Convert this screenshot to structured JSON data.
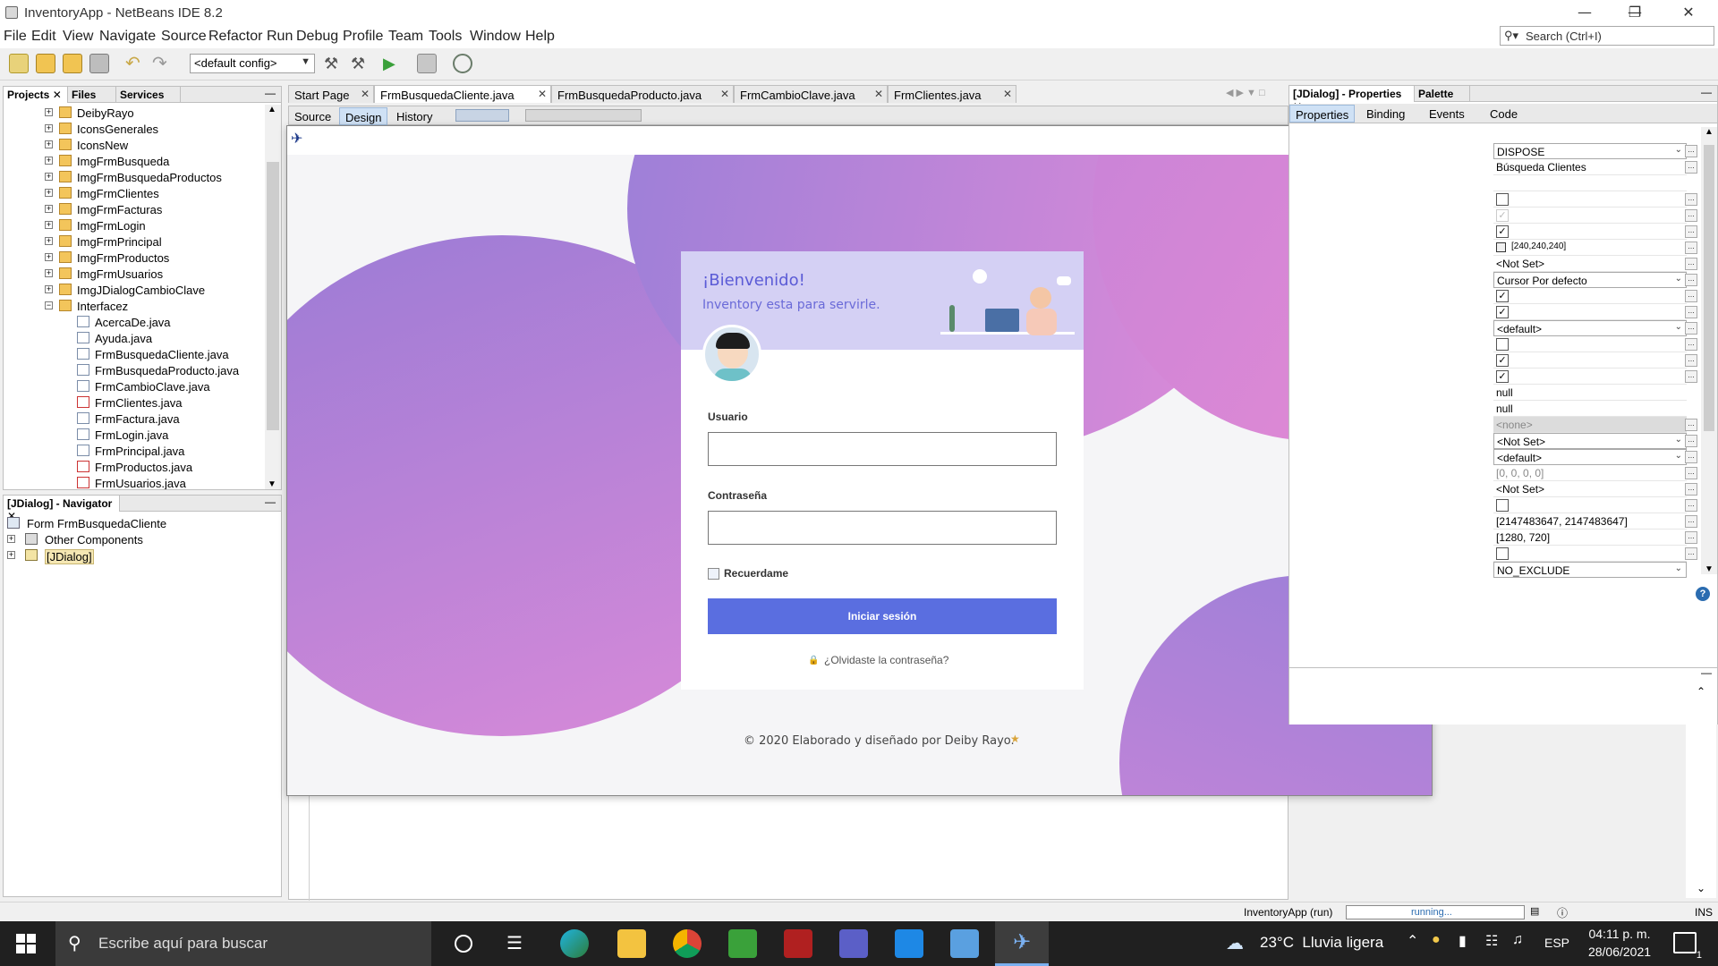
{
  "window": {
    "title": "InventoryApp - NetBeans IDE 8.2",
    "minimize": "—",
    "maximize": "❐",
    "close": "✕"
  },
  "menu": [
    "File",
    "Edit",
    "View",
    "Navigate",
    "Source",
    "Refactor",
    "Run",
    "Debug",
    "Profile",
    "Team",
    "Tools",
    "Window",
    "Help"
  ],
  "search": {
    "placeholder": "Search (Ctrl+I)"
  },
  "toolbar": {
    "config": "<default config>"
  },
  "projects_panel": {
    "tabs": [
      "Projects",
      "Files",
      "Services"
    ],
    "items": [
      {
        "label": "DeibyRayo",
        "type": "pkg"
      },
      {
        "label": "IconsGenerales",
        "type": "pkg"
      },
      {
        "label": "IconsNew",
        "type": "pkg"
      },
      {
        "label": "ImgFrmBusqueda",
        "type": "pkg"
      },
      {
        "label": "ImgFrmBusquedaProductos",
        "type": "pkg"
      },
      {
        "label": "ImgFrmClientes",
        "type": "pkg"
      },
      {
        "label": "ImgFrmFacturas",
        "type": "pkg"
      },
      {
        "label": "ImgFrmLogin",
        "type": "pkg"
      },
      {
        "label": "ImgFrmPrincipal",
        "type": "pkg"
      },
      {
        "label": "ImgFrmProductos",
        "type": "pkg"
      },
      {
        "label": "ImgFrmUsuarios",
        "type": "pkg"
      },
      {
        "label": "ImgJDialogCambioClave",
        "type": "pkg"
      },
      {
        "label": "Interfacez",
        "type": "pkg-open"
      },
      {
        "label": "AcercaDe.java",
        "type": "java"
      },
      {
        "label": "Ayuda.java",
        "type": "java"
      },
      {
        "label": "FrmBusquedaCliente.java",
        "type": "java"
      },
      {
        "label": "FrmBusquedaProducto.java",
        "type": "java"
      },
      {
        "label": "FrmCambioClave.java",
        "type": "java"
      },
      {
        "label": "FrmClientes.java",
        "type": "java-err"
      },
      {
        "label": "FrmFactura.java",
        "type": "java"
      },
      {
        "label": "FrmLogin.java",
        "type": "java"
      },
      {
        "label": "FrmPrincipal.java",
        "type": "java"
      },
      {
        "label": "FrmProductos.java",
        "type": "java-err"
      },
      {
        "label": "FrmUsuarios.java",
        "type": "java-err"
      }
    ]
  },
  "navigator_panel": {
    "tab": "[JDialog] - Navigator",
    "items": [
      "Form FrmBusquedaCliente",
      "Other Components",
      "[JDialog]"
    ]
  },
  "editor": {
    "tabs": [
      "Start Page",
      "FrmBusquedaCliente.java",
      "FrmBusquedaProducto.java",
      "FrmCambioClave.java",
      "FrmClientes.java"
    ],
    "subtabs": [
      "Source",
      "Design",
      "History"
    ]
  },
  "form": {
    "welcome": "¡Bienvenido!",
    "subtitle": "Inventory esta para servirle.",
    "user_label": "Usuario",
    "password_label": "Contraseña",
    "remember": "Recuerdame",
    "login_button": "Iniciar sesión",
    "forgot": "¿Olvidaste la contraseña?",
    "footer": "© 2020 Elaborado y diseñado por Deiby Rayo."
  },
  "properties_panel": {
    "tabs": [
      "[JDialog] - Properties",
      "Palette"
    ],
    "subtabs": [
      "Properties",
      "Binding",
      "Events",
      "Code"
    ],
    "values": [
      {
        "kind": "combo",
        "text": "DISPOSE"
      },
      {
        "kind": "text",
        "text": "Búsqueda Clientes"
      },
      {
        "kind": "blank",
        "text": ""
      },
      {
        "kind": "check",
        "checked": false
      },
      {
        "kind": "check-disabled",
        "checked": true
      },
      {
        "kind": "check",
        "checked": true
      },
      {
        "kind": "color",
        "text": "[240,240,240]"
      },
      {
        "kind": "text",
        "text": "<Not Set>"
      },
      {
        "kind": "combo",
        "text": "Cursor Por defecto"
      },
      {
        "kind": "check",
        "checked": true
      },
      {
        "kind": "check",
        "checked": true
      },
      {
        "kind": "combo",
        "text": "<default>"
      },
      {
        "kind": "check",
        "checked": false
      },
      {
        "kind": "check",
        "checked": true
      },
      {
        "kind": "check",
        "checked": true
      },
      {
        "kind": "text",
        "text": "null"
      },
      {
        "kind": "text",
        "text": "null"
      },
      {
        "kind": "disabled",
        "text": "<none>"
      },
      {
        "kind": "combo",
        "text": "<Not Set>"
      },
      {
        "kind": "combo",
        "text": "<default>"
      },
      {
        "kind": "text-gray",
        "text": "[0, 0, 0, 0]"
      },
      {
        "kind": "text",
        "text": "<Not Set>"
      },
      {
        "kind": "check",
        "checked": false
      },
      {
        "kind": "text",
        "text": "[2147483647, 2147483647]"
      },
      {
        "kind": "text",
        "text": "[1280, 720]"
      },
      {
        "kind": "check",
        "checked": false
      },
      {
        "kind": "combo",
        "text": "NO_EXCLUDE"
      }
    ]
  },
  "status": {
    "app": "InventoryApp (run)",
    "progress": "running...",
    "mode": "INS"
  },
  "taskbar": {
    "search_placeholder": "Escribe aquí para buscar",
    "weather": "23°C  Lluvia ligera",
    "lang": "ESP",
    "time": "04:11 p. m.",
    "date": "28/06/2021",
    "notifications": "1"
  },
  "colors": {
    "accent": "#5a6ee0",
    "blob_top": "#9b7fd6",
    "blob_pink": "#e27fd6",
    "card_header": "#d4d0f4"
  }
}
